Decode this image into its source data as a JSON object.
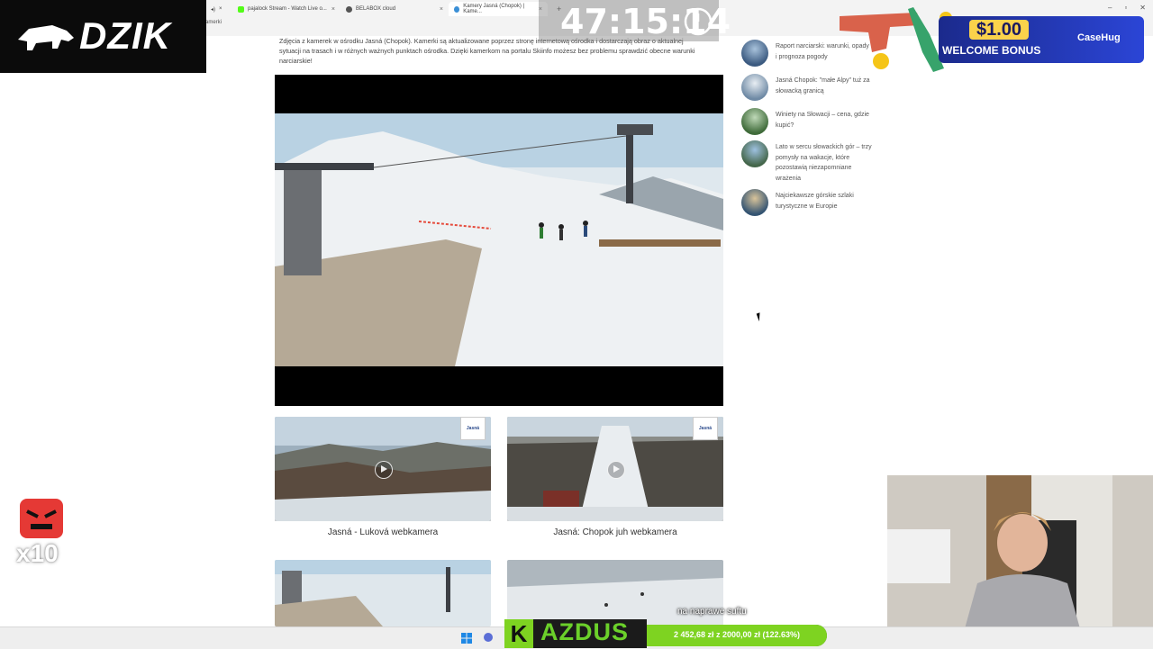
{
  "browser": {
    "tabs": [
      {
        "label": "pajalock Stream - Watch Live o...",
        "close": "×"
      },
      {
        "label": "BELABOX cloud",
        "close": "×"
      },
      {
        "label": "Kamery Jasná (Chopok) | Kame...",
        "close": "×"
      }
    ],
    "new_tab": "+",
    "address_fragment": "amerki"
  },
  "article": {
    "intro": "Zdjęcia z kamerek w ośrodku Jasná (Chopok). Kamerki są aktualizowane poprzez stronę internetową ośrodka i dostarczają obraz o aktualnej sytuacji na trasach i w różnych ważnych punktach ośrodka. Dzięki kamerkom na portalu Skiinfo możesz bez problemu sprawdzić obecne warunki narciarskie!"
  },
  "webcams": [
    {
      "title": "Jasná - Luková webkamera",
      "logo": "Jasná"
    },
    {
      "title": "Jasná: Chopok juh webkamera",
      "logo": "Jasná"
    },
    {
      "title": "",
      "logo": ""
    },
    {
      "title": "",
      "logo": ""
    }
  ],
  "sidebar": {
    "items": [
      {
        "label": "Raport narciarski: warunki, opady i prognoza pogody"
      },
      {
        "label": "Jasná Chopok: \"małe Alpy\" tuż za słowacką granicą"
      },
      {
        "label": "Winiety na Słowacji – cena, gdzie kupić?"
      },
      {
        "label": "Lato w sercu słowackich gór – trzy pomysły na wakacje, które pozostawią niezapomniane wrażenia"
      },
      {
        "label": "Najciekawsze górskie szlaki turystyczne w Europie"
      }
    ]
  },
  "overlay": {
    "brand": "DZIK",
    "timer": "47:15:14",
    "promo_amount": "$1.00",
    "promo_label": "WELCOME BONUS",
    "promo_brand": "CaseHug",
    "multiplier": "x10",
    "subtitle": "na naprawe suftu",
    "goal_letter": "K",
    "goal_name": "AZDUS",
    "goal_text": "2 452,68 zł z 2000,00 zł (122.63%)",
    "goal_fraction": 1.0
  },
  "colors": {
    "goal_green": "#7ed321",
    "promo_blue": "#2b45d6",
    "promo_gold": "#fbd24b"
  }
}
